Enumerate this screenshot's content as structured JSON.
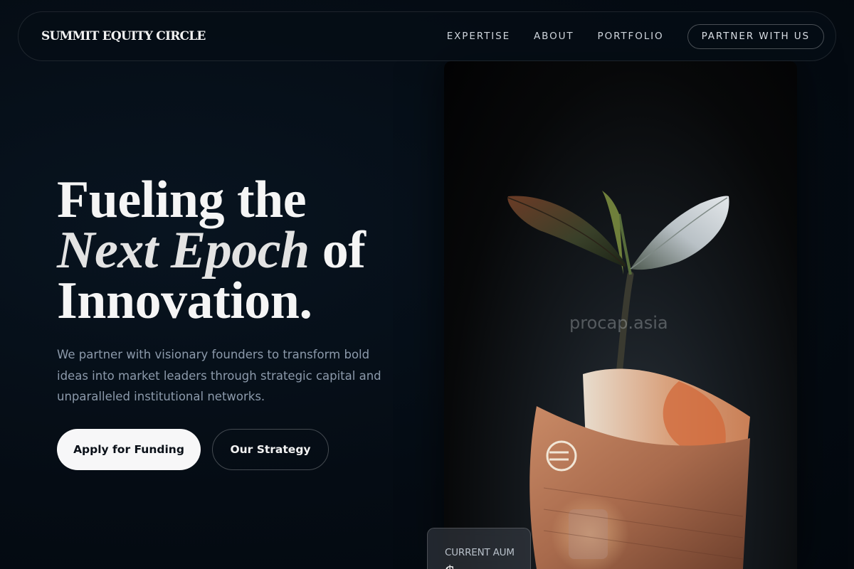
{
  "nav": {
    "brand": "SUMMIT EQUITY CIRCLE",
    "links": [
      {
        "label": "EXPERTISE"
      },
      {
        "label": "ABOUT"
      },
      {
        "label": "PORTFOLIO"
      }
    ],
    "cta": "PARTNER WITH US"
  },
  "hero": {
    "headline_line1": "Fueling the",
    "headline_em": "Next Epoch",
    "headline_line2_end": " of",
    "headline_line3": "Innovation.",
    "subtext": "We partner with visionary founders to transform bold ideas into market leaders through strategic capital and unparalleled institutional networks.",
    "primary_button": "Apply for Funding",
    "secondary_button": "Our Strategy"
  },
  "image": {
    "watermark": "procap.asia",
    "subject": "seedling-growing-from-euro-banknote"
  },
  "aum_card": {
    "label": "CURRENT AUM",
    "value": "$..."
  },
  "colors": {
    "background": "#050c14",
    "accent_text": "#8c9aab",
    "primary_button_bg": "#f7f7f8"
  }
}
